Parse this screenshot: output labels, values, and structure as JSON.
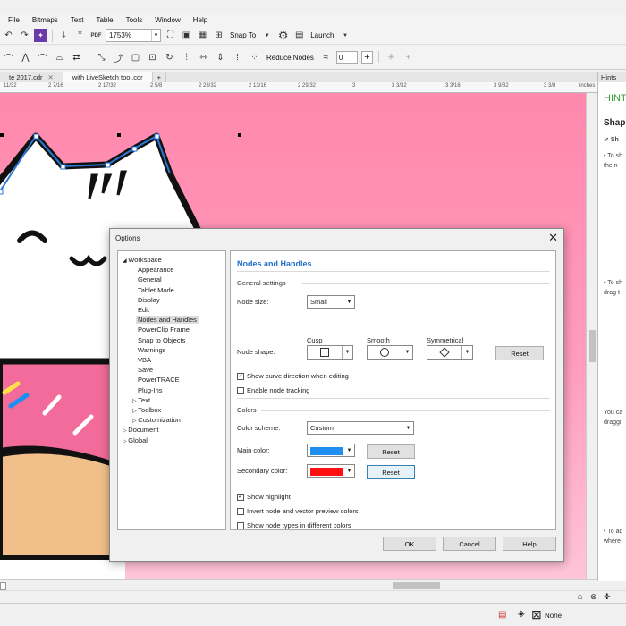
{
  "menu": [
    "File",
    "Bitmaps",
    "Text",
    "Table",
    "Tools",
    "Window",
    "Help"
  ],
  "toolbar": {
    "zoom": "1753%",
    "snap_label": "Snap To",
    "launch_label": "Launch",
    "reduce_nodes_label": "Reduce Nodes",
    "smooth_value": "0",
    "pdf_label": "PDF"
  },
  "tabs": [
    {
      "label": "te 2017.cdr"
    },
    {
      "label": "with LiveSketch tool.cdr"
    }
  ],
  "ruler": [
    "11/32",
    "2 7/16",
    "2 17/32",
    "2 5/8",
    "2 23/32",
    "2 13/16",
    "2 29/32",
    "3",
    "3 3/32",
    "3 3/16",
    "3 9/32",
    "3 3/8",
    "inches"
  ],
  "hints": {
    "title": "Hints",
    "header": "HINT",
    "subtitle": "Shap",
    "sub2": "Sh",
    "lines": [
      "• To sh",
      "the n",
      "• To sh",
      "drag t",
      "You ca",
      "draggi",
      "• To ad",
      "where"
    ]
  },
  "dialog": {
    "title": "Options",
    "tree": [
      {
        "label": "Workspace",
        "arrow": "◢",
        "indent": 0
      },
      {
        "label": "Appearance",
        "indent": 2
      },
      {
        "label": "General",
        "indent": 2
      },
      {
        "label": "Tablet Mode",
        "indent": 2
      },
      {
        "label": "Display",
        "indent": 2
      },
      {
        "label": "Edit",
        "indent": 2
      },
      {
        "label": "Nodes and Handles",
        "indent": 2,
        "selected": true
      },
      {
        "label": "PowerClip Frame",
        "indent": 2
      },
      {
        "label": "Snap to Objects",
        "indent": 2
      },
      {
        "label": "Warnings",
        "indent": 2
      },
      {
        "label": "VBA",
        "indent": 2
      },
      {
        "label": "Save",
        "indent": 2
      },
      {
        "label": "PowerTRACE",
        "indent": 2
      },
      {
        "label": "Plug-Ins",
        "indent": 2
      },
      {
        "label": "Text",
        "arrow": "▷",
        "indent": 1
      },
      {
        "label": "Toolbox",
        "arrow": "▷",
        "indent": 1
      },
      {
        "label": "Customization",
        "arrow": "▷",
        "indent": 1
      },
      {
        "label": "Document",
        "arrow": "▷",
        "indent": 0
      },
      {
        "label": "Global",
        "arrow": "▷",
        "indent": 0
      }
    ],
    "panel_title": "Nodes and Handles",
    "general_settings": "General settings",
    "node_size_label": "Node size:",
    "node_size_value": "Small",
    "node_shape_label": "Node shape:",
    "cusp_label": "Cusp",
    "smooth_label": "Smooth",
    "symmetrical_label": "Symmetrical",
    "reset_label": "Reset",
    "show_curve_direction": "Show curve direction when editing",
    "enable_node_tracking": "Enable node tracking",
    "colors_section": "Colors",
    "color_scheme_label": "Color scheme:",
    "color_scheme_value": "Custom",
    "main_color_label": "Main color:",
    "main_color": "#1e8ff0",
    "secondary_color_label": "Secondary color:",
    "secondary_color": "#ff1010",
    "show_highlight": "Show highlight",
    "invert_node": "Invert node and vector preview colors",
    "show_node_types": "Show node types in different colors",
    "checks": {
      "show_curve_direction": true,
      "enable_node_tracking": false,
      "show_highlight": true,
      "invert_node": false,
      "show_node_types": false
    },
    "ok_label": "OK",
    "cancel_label": "Cancel",
    "help_label": "Help"
  },
  "status": {
    "fill_label": "None"
  },
  "colors": {
    "canvas_top": "#ff88ad",
    "canvas_bottom": "#ffc4d7",
    "accent": "#1f6ec8",
    "hint_green": "#3a9a3a"
  }
}
